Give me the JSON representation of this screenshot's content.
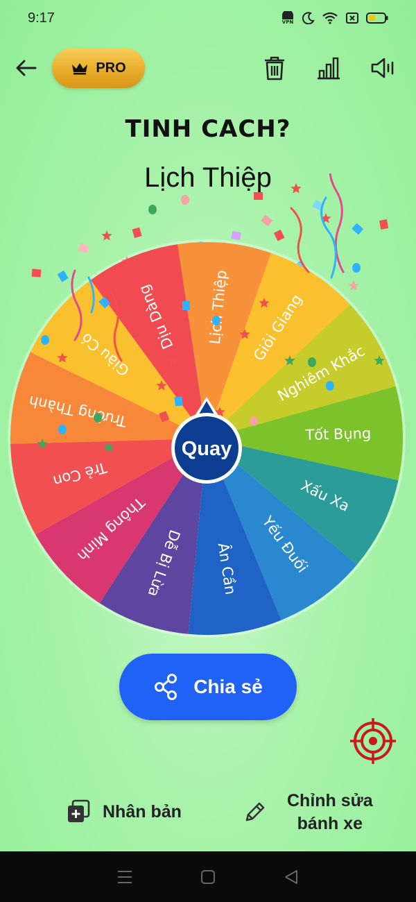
{
  "status_bar": {
    "time": "9:17",
    "vpn_label": "VPN"
  },
  "top_bar": {
    "pro_label": "PRO"
  },
  "wheel": {
    "title": "TINH CACH?",
    "result": "Lịch Thiệp",
    "center_label": "Quay",
    "segments": [
      {
        "label": "Lịch Thiệp",
        "color": "#f7923a"
      },
      {
        "label": "Giỏi Giang",
        "color": "#fbc02d"
      },
      {
        "label": "Nghiêm Khắc",
        "color": "#c6cc2b"
      },
      {
        "label": "Tốt Bụng",
        "color": "#7cc32b"
      },
      {
        "label": "Xấu Xa",
        "color": "#2b9c97"
      },
      {
        "label": "Yếu Đuối",
        "color": "#2a88cf"
      },
      {
        "label": "Ân Cần",
        "color": "#1f63c6"
      },
      {
        "label": "Dễ Bị Lừa",
        "color": "#5e46a0"
      },
      {
        "label": "Thông Minh",
        "color": "#d9376f"
      },
      {
        "label": "Trẻ Con",
        "color": "#f14f50"
      },
      {
        "label": "Trưởng Thành",
        "color": "#f7883a"
      },
      {
        "label": "Giàu Có",
        "color": "#fbc02d"
      },
      {
        "label": "Dịu Dàng",
        "color": "#f14a50"
      }
    ]
  },
  "share": {
    "label": "Chia sẻ"
  },
  "bottom_actions": {
    "duplicate_label": "Nhân bản",
    "edit_label_line1": "Chỉnh sửa",
    "edit_label_line2": "bánh xe"
  },
  "colors": {
    "accent": "#1f62f5",
    "background": "#a9f3ab",
    "pointer": "#0b3d91"
  }
}
